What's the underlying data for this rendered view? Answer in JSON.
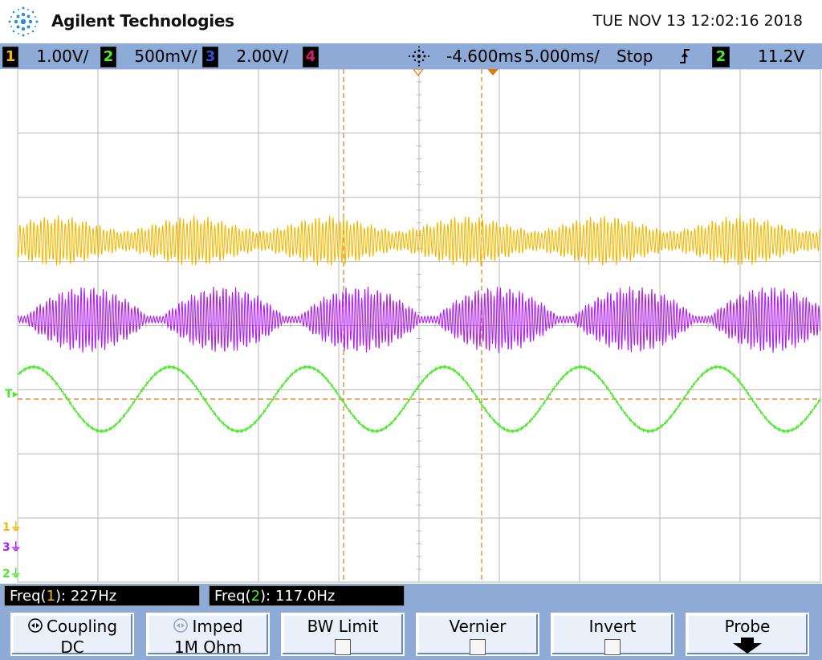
{
  "header": {
    "brand": "Agilent Technologies",
    "datetime": "TUE NOV 13 12:02:16 2018"
  },
  "status": {
    "ch1_num": "1",
    "ch1_scale": "1.00V/",
    "ch2_num": "2",
    "ch2_scale": "500mV/",
    "ch3_num": "3",
    "ch3_scale": "2.00V/",
    "ch4_num": "4",
    "time_delay": "-4.600ms",
    "time_scale": "5.000ms/",
    "run_state": "Stop",
    "trigger_source": "2",
    "trigger_level": "11.2V"
  },
  "markers": {
    "trigger": "T",
    "ch1": "1",
    "ch3": "3",
    "ch2": "2"
  },
  "measurements": {
    "m1_prefix": "Freq(",
    "m1_ch": "1",
    "m1_suffix": "): 227Hz",
    "m2_prefix": "Freq(",
    "m2_ch": "2",
    "m2_suffix": "): 117.0Hz"
  },
  "softkeys": {
    "coupling_l1": "Coupling",
    "coupling_l2": "DC",
    "imped_l1": "Imped",
    "imped_l2": "1M Ohm",
    "bwlimit_l1": "BW Limit",
    "vernier_l1": "Vernier",
    "invert_l1": "Invert",
    "probe_l1": "Probe"
  },
  "colors": {
    "ch1": "#f5b800",
    "ch2": "#4ce82a",
    "ch3": "#2f4fd6",
    "ch4": "#d61f63",
    "ch_math": "#b020f0",
    "cursor": "#e07a10",
    "grid": "#b8b8b8",
    "bar": "#8eaad6"
  },
  "waveform_info": {
    "ch2_frequency_hz": 117.0,
    "ch1_frequency_hz": 227
  }
}
